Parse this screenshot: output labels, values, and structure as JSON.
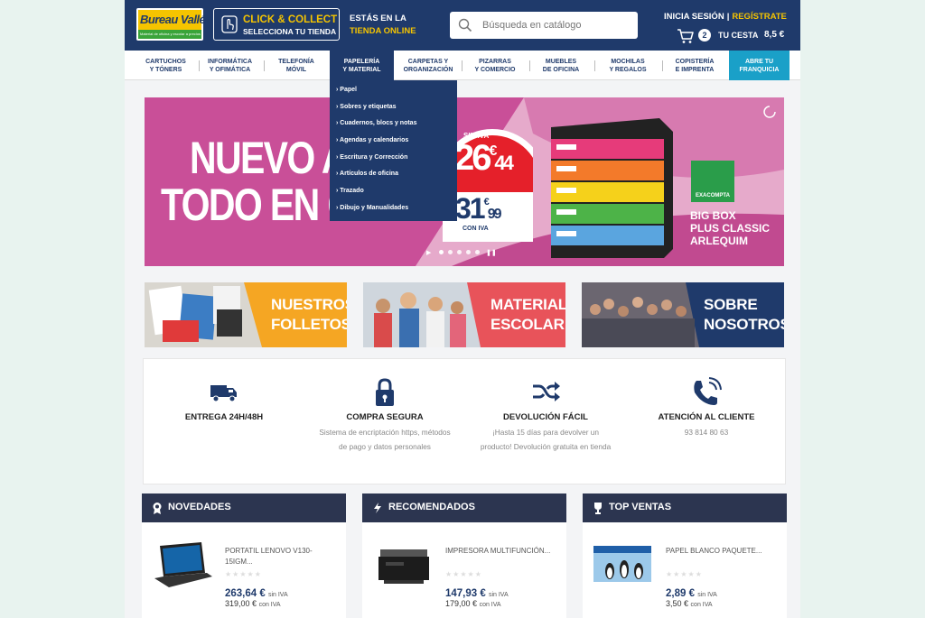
{
  "header": {
    "logo_text": "Bureau Vallée",
    "logo_tagline": "Material de oficina y escolar a precios bajos",
    "click_collect": {
      "line1": "CLICK & COLLECT",
      "line2": "SELECCIONA TU TIENDA"
    },
    "store": {
      "line1": "ESTÁS EN LA",
      "line2": "TIENDA ONLINE"
    },
    "search_placeholder": "Búsqueda en catálogo",
    "login": "INICIA SESIÓN",
    "separator": "|",
    "register": "REGÍSTRATE",
    "cart_count": "2",
    "cart_label": "TU CESTA",
    "cart_total": "8,5 €"
  },
  "nav": {
    "items": [
      {
        "line1": "CARTUCHOS",
        "line2": "Y TÓNERS"
      },
      {
        "line1": "INFORMÁTICA",
        "line2": "Y OFIMÁTICA"
      },
      {
        "line1": "TELEFONÍA",
        "line2": "MÓVIL"
      },
      {
        "line1": "PAPELERÍA",
        "line2": "Y MATERIAL"
      },
      {
        "line1": "CARPETAS Y",
        "line2": "ORGANIZACIÓN"
      },
      {
        "line1": "PIZARRAS",
        "line2": "Y COMERCIO"
      },
      {
        "line1": "MUEBLES",
        "line2": "DE OFICINA"
      },
      {
        "line1": "MOCHILAS",
        "line2": "Y REGALOS"
      },
      {
        "line1": "COPISTERÍA",
        "line2": "E IMPRENTA"
      },
      {
        "line1": "ABRE TU",
        "line2": "FRANQUICIA"
      }
    ],
    "dropdown": [
      "› Papel",
      "› Sobres y etiquetas",
      "› Cuadernos, blocs y notas",
      "› Agendas y calendarios",
      "› Escritura y Corrección",
      "› Artículos de oficina",
      "› Trazado",
      "› Dibujo y Manualidades"
    ]
  },
  "banner": {
    "headline1": "NUEVO AÑ",
    "headline2": "TODO EN OR",
    "headline2_tail": "DEN",
    "sin_iva_label": "SIN IVA",
    "price_sin_iva_int": "26",
    "price_sin_iva_dec": "44",
    "price_con_iva_int": "31",
    "price_con_iva_dec": "99",
    "currency": "€",
    "con_iva_label": "CON IVA",
    "brand": "EXACOMPTA",
    "product": [
      "BIG BOX",
      "PLUS CLASSIC",
      "ARLEQUIM"
    ],
    "slides": 5,
    "active_slide": 1
  },
  "promos": [
    {
      "line1": "NUESTROS",
      "line2": "FOLLETOS >"
    },
    {
      "line1": "MATERIAL",
      "line2": "ESCOLAR >"
    },
    {
      "line1": "SOBRE",
      "line2": "NOSOTROS >"
    }
  ],
  "features": [
    {
      "icon": "truck-icon",
      "title": "ENTREGA 24H/48H",
      "desc": ""
    },
    {
      "icon": "lock-icon",
      "title": "COMPRA SEGURA",
      "desc": "Sistema de encriptación https, métodos de pago y datos personales"
    },
    {
      "icon": "shuffle-icon",
      "title": "DEVOLUCIÓN FÁCIL",
      "desc": "¡Hasta 15 días para devolver un producto! Devolución gratuita en tienda"
    },
    {
      "icon": "phone-icon",
      "title": "ATENCIÓN AL CLIENTE",
      "desc": "93 814 80 63"
    }
  ],
  "products": [
    {
      "section": "NOVEDADES",
      "icon": "award-icon",
      "name": "PORTATIL LENOVO V130-15IGM...",
      "stars": "★★★★★",
      "price": "263,64 €",
      "price_label": "sin IVA",
      "price_iva": "319,00 €",
      "price_iva_label": "con IVA"
    },
    {
      "section": "RECOMENDADOS",
      "icon": "bolt-icon",
      "name": "IMPRESORA MULTIFUNCIÓN...",
      "stars": "★★★★★",
      "price": "147,93 €",
      "price_label": "sin IVA",
      "price_iva": "179,00 €",
      "price_iva_label": "con IVA"
    },
    {
      "section": "TOP VENTAS",
      "icon": "trophy-icon",
      "name": "PAPEL BLANCO PAQUETE...",
      "stars": "★★★★★",
      "price": "2,89 €",
      "price_label": "sin IVA",
      "price_iva": "3,50 €",
      "price_iva_label": "con IVA"
    }
  ],
  "colors": {
    "brand_blue": "#1f3a6b",
    "brand_yellow": "#f5c400",
    "franchise": "#1aa0c8",
    "box_header": "#2c3550"
  }
}
